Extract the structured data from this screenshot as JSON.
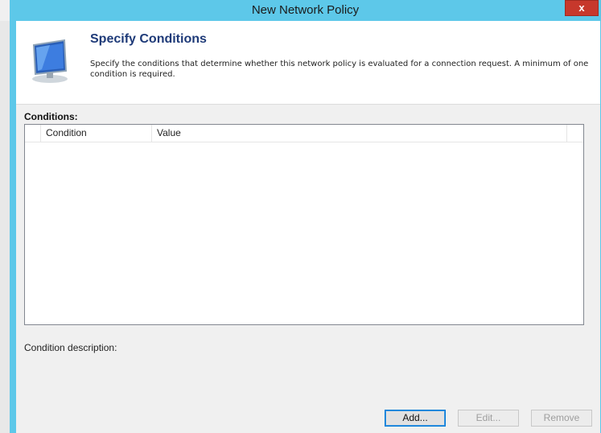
{
  "window": {
    "title": "New Network Policy",
    "close_glyph": "x"
  },
  "header": {
    "title": "Specify Conditions",
    "description": "Specify the conditions that determine whether this network policy is evaluated for a connection request. A minimum of one condition is required.",
    "icon": "computer-monitor-icon"
  },
  "conditions": {
    "label": "Conditions:",
    "columns": [
      "",
      "Condition",
      "Value"
    ],
    "rows": []
  },
  "condition_description_label": "Condition description:",
  "buttons": {
    "add": "Add...",
    "edit": "Edit...",
    "remove": "Remove"
  },
  "colors": {
    "titlebar": "#5dc8e9",
    "title_text_accent": "#1e3a78",
    "close_button": "#c7382c"
  }
}
